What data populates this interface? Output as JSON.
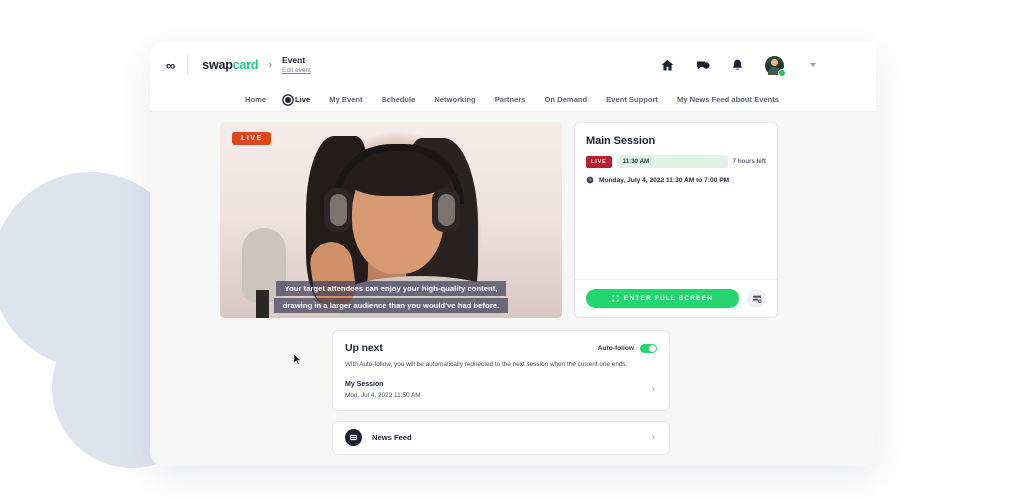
{
  "header": {
    "infinity_logo": "∞",
    "brand_prefix": "swap",
    "brand_suffix": "card",
    "breadcrumb_sep": "›",
    "event_title": "Event",
    "event_edit_link": "Edit event",
    "icons": {
      "home": "home-icon",
      "chat": "chat-bubbles-icon",
      "bell": "bell-icon",
      "avatar": "avatar",
      "chevron": "chevron-down-icon"
    }
  },
  "nav": {
    "items": [
      {
        "label": "Home",
        "active": false
      },
      {
        "label": "Live",
        "active": true
      },
      {
        "label": "My Event",
        "active": false
      },
      {
        "label": "Schedule",
        "active": false
      },
      {
        "label": "Networking",
        "active": false
      },
      {
        "label": "Partners",
        "active": false
      },
      {
        "label": "On Demand",
        "active": false
      },
      {
        "label": "Event Support",
        "active": false
      },
      {
        "label": "My News Feed about Events",
        "active": false
      }
    ]
  },
  "video": {
    "live_badge": "LIVE",
    "caption_line_1": "Your target attendees can enjoy your high-quality content,",
    "caption_line_2": "drawing in a larger audience than you would've had before."
  },
  "session": {
    "title": "Main Session",
    "live_tag": "LIVE",
    "time_tag": "11:30 AM",
    "time_left": "7 hours left",
    "date_range": "Monday, July 4, 2022 11:30 AM to 7:00 PM",
    "fullscreen_button": "ENTER FULL SCREEN",
    "layout_button_icon": "layout-settings-icon",
    "clock_icon": "clock-icon",
    "expand_icon": "expand-icon"
  },
  "up_next": {
    "title": "Up next",
    "toggle_label": "Auto-follow",
    "toggle_on": true,
    "description": "With Auto-follow, you will be automatically redirected to the next session when the current one ends.",
    "session_title": "My Session",
    "session_date": "Mon, Jul 4, 2022 11:50 AM",
    "chevron": "›"
  },
  "news_feed": {
    "label": "News Feed",
    "icon": "newspaper-icon",
    "chevron": "›"
  },
  "colors": {
    "accent_green": "#24d56e",
    "brand_green": "#22c977",
    "live_red": "#e0461b",
    "session_live_red": "#b92030",
    "dark_text": "#1c2235",
    "blob": "#dfe3ee",
    "window_bg": "#f6f6f7"
  }
}
